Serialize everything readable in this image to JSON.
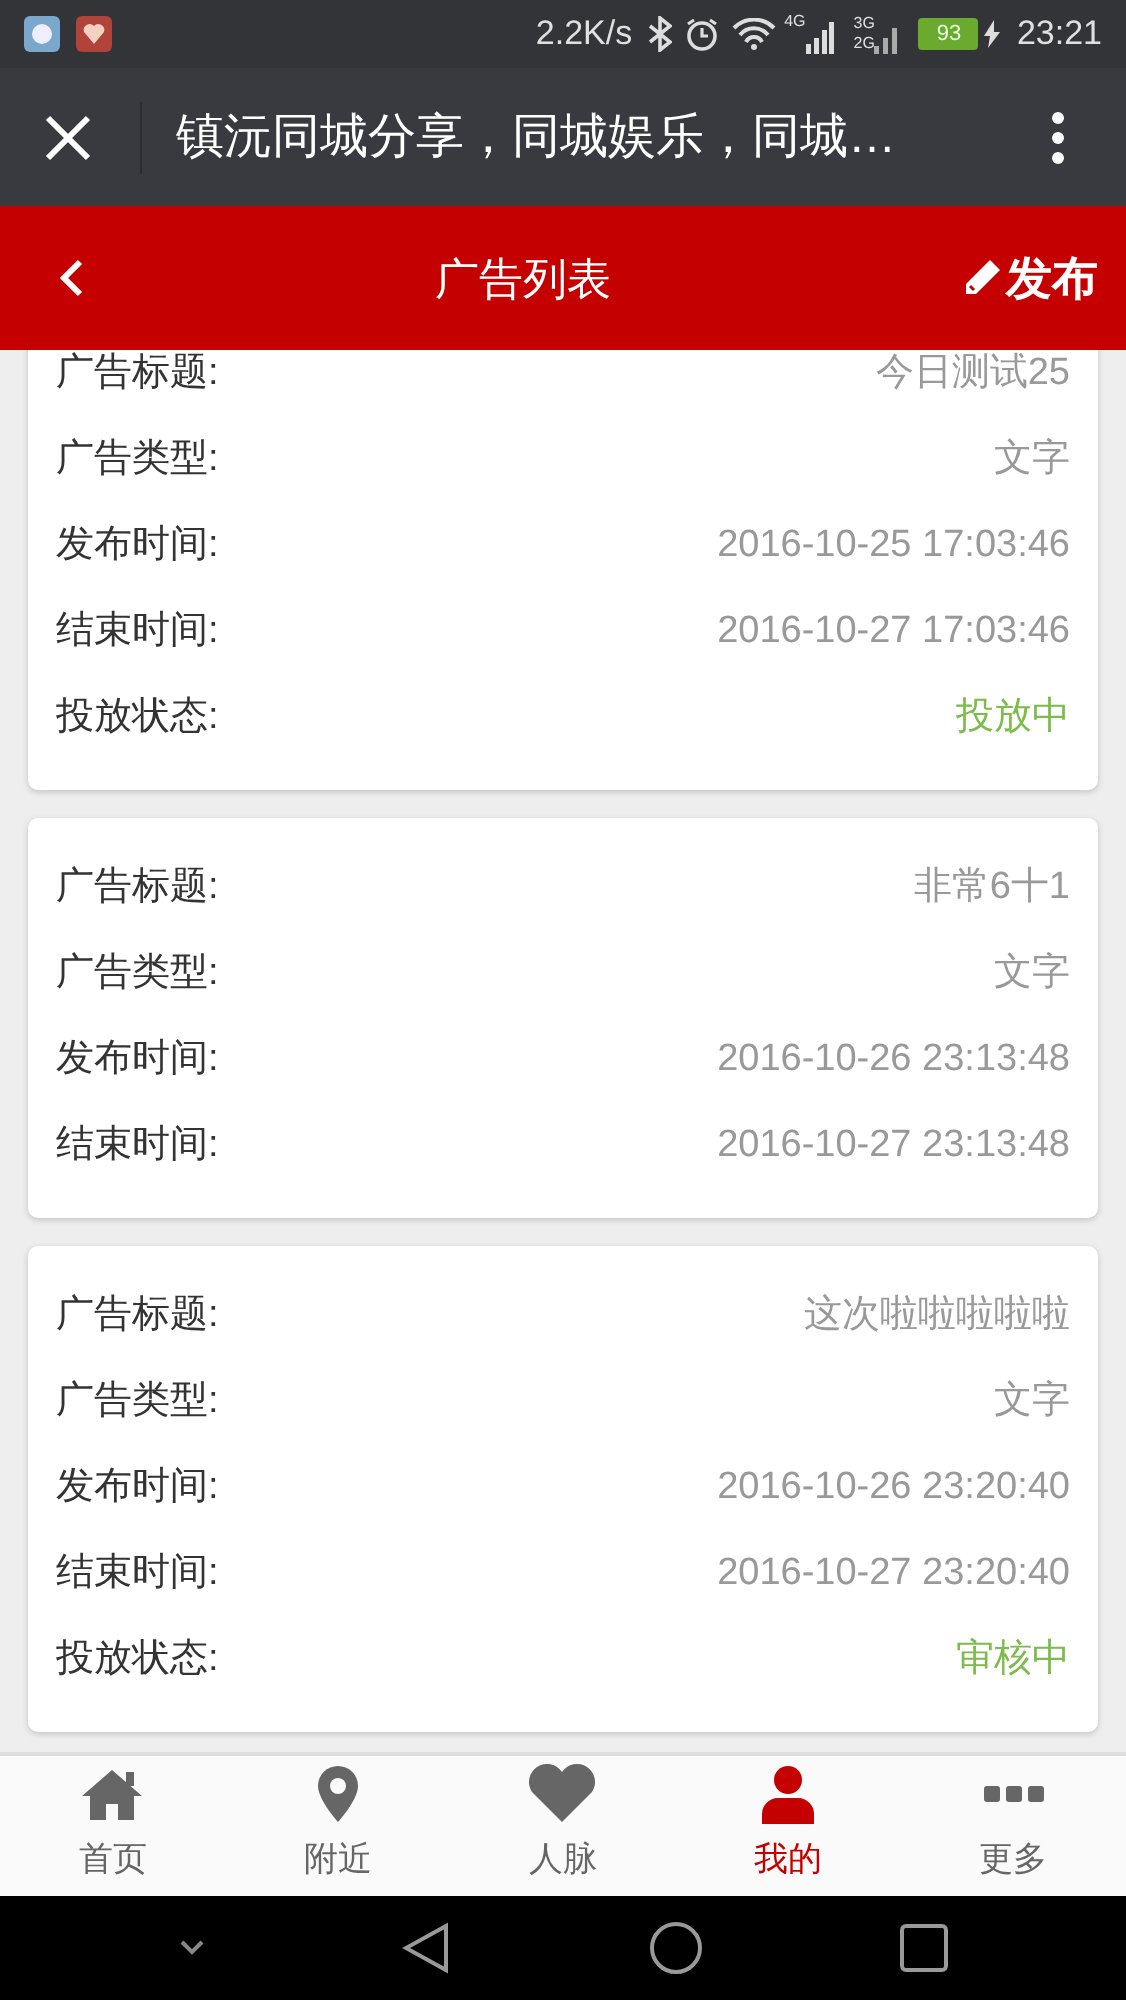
{
  "status_bar": {
    "speed": "2.2K/s",
    "network_1": "4G",
    "network_2a": "3G",
    "network_2b": "2G",
    "battery": "93",
    "time": "23:21"
  },
  "browser_bar": {
    "title": "镇沅同城分享，同城娱乐，同城…"
  },
  "header": {
    "title": "广告列表",
    "action": "发布"
  },
  "cards": [
    {
      "fields": [
        {
          "kind": "text",
          "label": "广告标题:",
          "value": "今日测试25"
        },
        {
          "kind": "text",
          "label": "广告类型:",
          "value": "文字"
        },
        {
          "kind": "text",
          "label": "发布时间:",
          "value": "2016-10-25 17:03:46"
        },
        {
          "kind": "text",
          "label": "结束时间:",
          "value": "2016-10-27 17:03:46"
        },
        {
          "kind": "status",
          "label": "投放状态:",
          "value": "投放中"
        }
      ]
    },
    {
      "fields": [
        {
          "kind": "text",
          "label": "广告标题:",
          "value": "非常6十1"
        },
        {
          "kind": "text",
          "label": "广告类型:",
          "value": "文字"
        },
        {
          "kind": "text",
          "label": "发布时间:",
          "value": "2016-10-26 23:13:48"
        },
        {
          "kind": "text",
          "label": "结束时间:",
          "value": "2016-10-27 23:13:48"
        }
      ]
    },
    {
      "fields": [
        {
          "kind": "text",
          "label": "广告标题:",
          "value": "这次啦啦啦啦啦"
        },
        {
          "kind": "text",
          "label": "广告类型:",
          "value": "文字"
        },
        {
          "kind": "text",
          "label": "发布时间:",
          "value": "2016-10-26 23:20:40"
        },
        {
          "kind": "text",
          "label": "结束时间:",
          "value": "2016-10-27 23:20:40"
        },
        {
          "kind": "status",
          "label": "投放状态:",
          "value": "审核中"
        }
      ]
    }
  ],
  "bottom_nav": [
    {
      "label": "首页",
      "selected": false
    },
    {
      "label": "附近",
      "selected": false
    },
    {
      "label": "人脉",
      "selected": false
    },
    {
      "label": "我的",
      "selected": true
    },
    {
      "label": "更多",
      "selected": false
    }
  ]
}
